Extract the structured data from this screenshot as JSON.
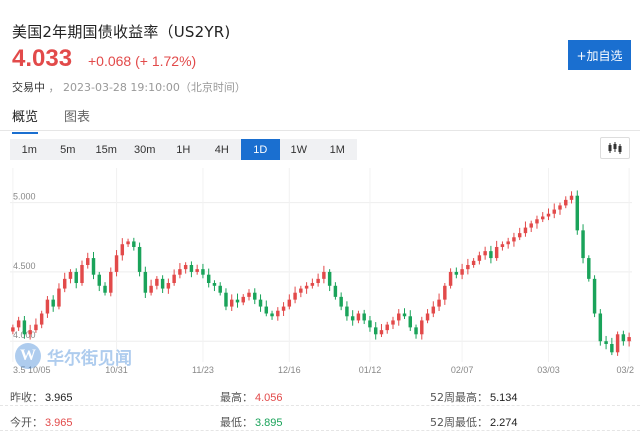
{
  "header": {
    "title": "美国2年期国债收益率（US2YR)",
    "price": "4.033",
    "change": "+0.068 (+ 1.72%)",
    "status": "交易中",
    "timestamp": "2023-03-28 19:10:00（北京时间）",
    "add_button": "+加自选"
  },
  "tabs": [
    {
      "label": "概览",
      "active": true
    },
    {
      "label": "图表",
      "active": false
    }
  ],
  "periods": [
    "1m",
    "5m",
    "15m",
    "30m",
    "1H",
    "4H",
    "1D",
    "1W",
    "1M"
  ],
  "active_period": "1D",
  "watermark": {
    "logo": "W",
    "text": "华尔街见闻"
  },
  "stats": {
    "prev_close_label": "昨收：",
    "prev_close": "3.965",
    "high_label": "最高：",
    "high": "4.056",
    "w52_high_label": "52周最高：",
    "w52_high": "5.134",
    "open_label": "今开：",
    "open": "3.965",
    "low_label": "最低：",
    "low": "3.895",
    "w52_low_label": "52周最低：",
    "w52_low": "2.274"
  },
  "colors": {
    "up": "#e24a4a",
    "down": "#1aa35a",
    "accent": "#1a6fd0"
  },
  "chart_data": {
    "type": "candlestick",
    "y_ticks": [
      "5.000",
      "4.500",
      "4.000"
    ],
    "y_tick_values": [
      5.0,
      4.5,
      4.0
    ],
    "ylim": [
      3.85,
      5.25
    ],
    "x_ticks": [
      "3.5 10/05",
      "10/31",
      "11/23",
      "12/16",
      "01/12",
      "02/07",
      "03/03",
      "03/2"
    ],
    "x_tick_index": [
      0,
      18,
      33,
      48,
      62,
      78,
      93,
      107
    ],
    "grid": true,
    "closes": [
      4.1,
      4.15,
      4.05,
      4.08,
      4.12,
      4.2,
      4.3,
      4.25,
      4.38,
      4.45,
      4.5,
      4.42,
      4.55,
      4.6,
      4.48,
      4.4,
      4.35,
      4.5,
      4.62,
      4.7,
      4.72,
      4.68,
      4.5,
      4.35,
      4.4,
      4.45,
      4.38,
      4.42,
      4.48,
      4.52,
      4.55,
      4.5,
      4.52,
      4.48,
      4.42,
      4.4,
      4.35,
      4.25,
      4.3,
      4.28,
      4.32,
      4.35,
      4.3,
      4.25,
      4.2,
      4.18,
      4.22,
      4.25,
      4.3,
      4.35,
      4.38,
      4.4,
      4.42,
      4.45,
      4.5,
      4.4,
      4.32,
      4.25,
      4.18,
      4.15,
      4.2,
      4.15,
      4.1,
      4.05,
      4.08,
      4.12,
      4.15,
      4.2,
      4.18,
      4.1,
      4.05,
      4.15,
      4.2,
      4.25,
      4.3,
      4.4,
      4.5,
      4.48,
      4.52,
      4.55,
      4.58,
      4.62,
      4.65,
      4.6,
      4.68,
      4.7,
      4.72,
      4.75,
      4.78,
      4.82,
      4.85,
      4.88,
      4.9,
      4.92,
      4.95,
      4.98,
      5.02,
      5.05,
      4.8,
      4.6,
      4.45,
      4.2,
      4.0,
      3.98,
      3.92,
      4.05,
      4.0,
      4.03
    ]
  }
}
